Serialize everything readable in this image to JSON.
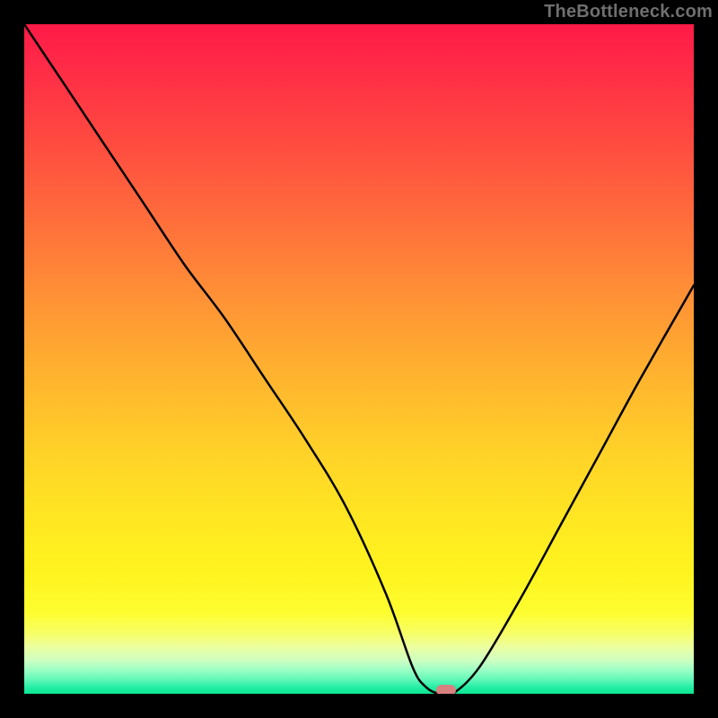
{
  "watermark": "TheBottleneck.com",
  "chart_data": {
    "type": "line",
    "title": "",
    "xlabel": "",
    "ylabel": "",
    "xlim": [
      0,
      100
    ],
    "ylim": [
      0,
      100
    ],
    "x": [
      0,
      6,
      12,
      18,
      24,
      30,
      36,
      42,
      48,
      54,
      58,
      60,
      62,
      64,
      68,
      74,
      80,
      86,
      92,
      100
    ],
    "values": [
      100,
      91,
      82,
      73,
      64,
      56,
      47,
      38,
      28,
      15,
      4,
      1,
      0,
      0,
      4,
      14,
      25,
      36,
      47,
      61
    ],
    "marker": {
      "x": 63,
      "y": 0
    },
    "gradient_stops": [
      {
        "pos": 0,
        "color": "#ff1a47"
      },
      {
        "pos": 50,
        "color": "#ffb22f"
      },
      {
        "pos": 85,
        "color": "#fff41f"
      },
      {
        "pos": 100,
        "color": "#0be694"
      }
    ]
  }
}
